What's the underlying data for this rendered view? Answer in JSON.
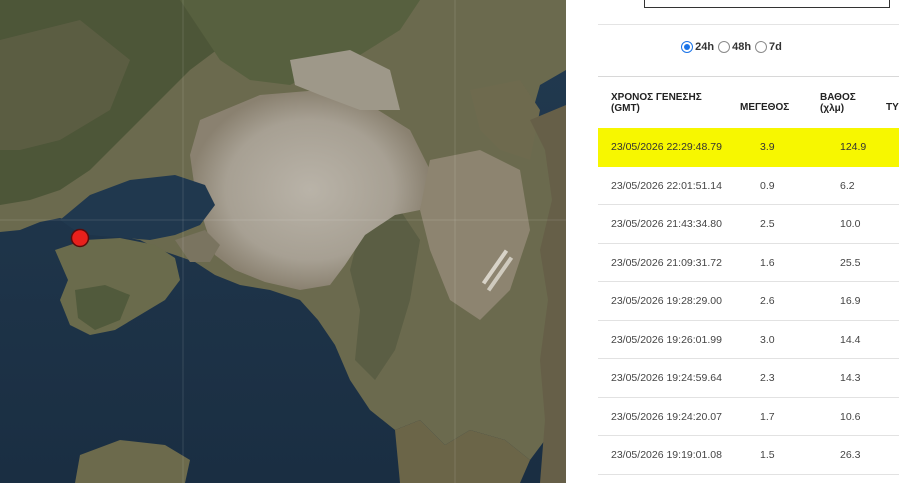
{
  "time_range": {
    "options": [
      {
        "label": "24h",
        "selected": true
      },
      {
        "label": "48h",
        "selected": false
      },
      {
        "label": "7d",
        "selected": false
      }
    ]
  },
  "table": {
    "headers": {
      "time_line1": "ΧΡΟΝΟΣ ΓΕΝΕΣΗΣ",
      "time_line2": "(GMT)",
      "magnitude": "ΜΕΓΕΘΟΣ",
      "depth_line1": "ΒΑΘΟΣ",
      "depth_line2": "(χλμ)",
      "type_partial": "ΤΥ"
    },
    "rows": [
      {
        "time": "23/05/2026 22:29:48.79",
        "magnitude": "3.9",
        "depth": "124.9",
        "highlighted": true
      },
      {
        "time": "23/05/2026 22:01:51.14",
        "magnitude": "0.9",
        "depth": "6.2"
      },
      {
        "time": "23/05/2026 21:43:34.80",
        "magnitude": "2.5",
        "depth": "10.0"
      },
      {
        "time": "23/05/2026 21:09:31.72",
        "magnitude": "1.6",
        "depth": "25.5"
      },
      {
        "time": "23/05/2026 19:28:29.00",
        "magnitude": "2.6",
        "depth": "16.9"
      },
      {
        "time": "23/05/2026 19:26:01.99",
        "magnitude": "3.0",
        "depth": "14.4"
      },
      {
        "time": "23/05/2026 19:24:59.64",
        "magnitude": "2.3",
        "depth": "14.3"
      },
      {
        "time": "23/05/2026 19:24:20.07",
        "magnitude": "1.7",
        "depth": "10.6"
      },
      {
        "time": "23/05/2026 19:19:01.08",
        "magnitude": "1.5",
        "depth": "26.3"
      }
    ]
  },
  "colors": {
    "highlight_row": "#f7f700",
    "radio_selected": "#1a73e8",
    "epicenter_marker": "#e8201c"
  },
  "map": {
    "marker_icon": "epicenter-marker-icon"
  }
}
